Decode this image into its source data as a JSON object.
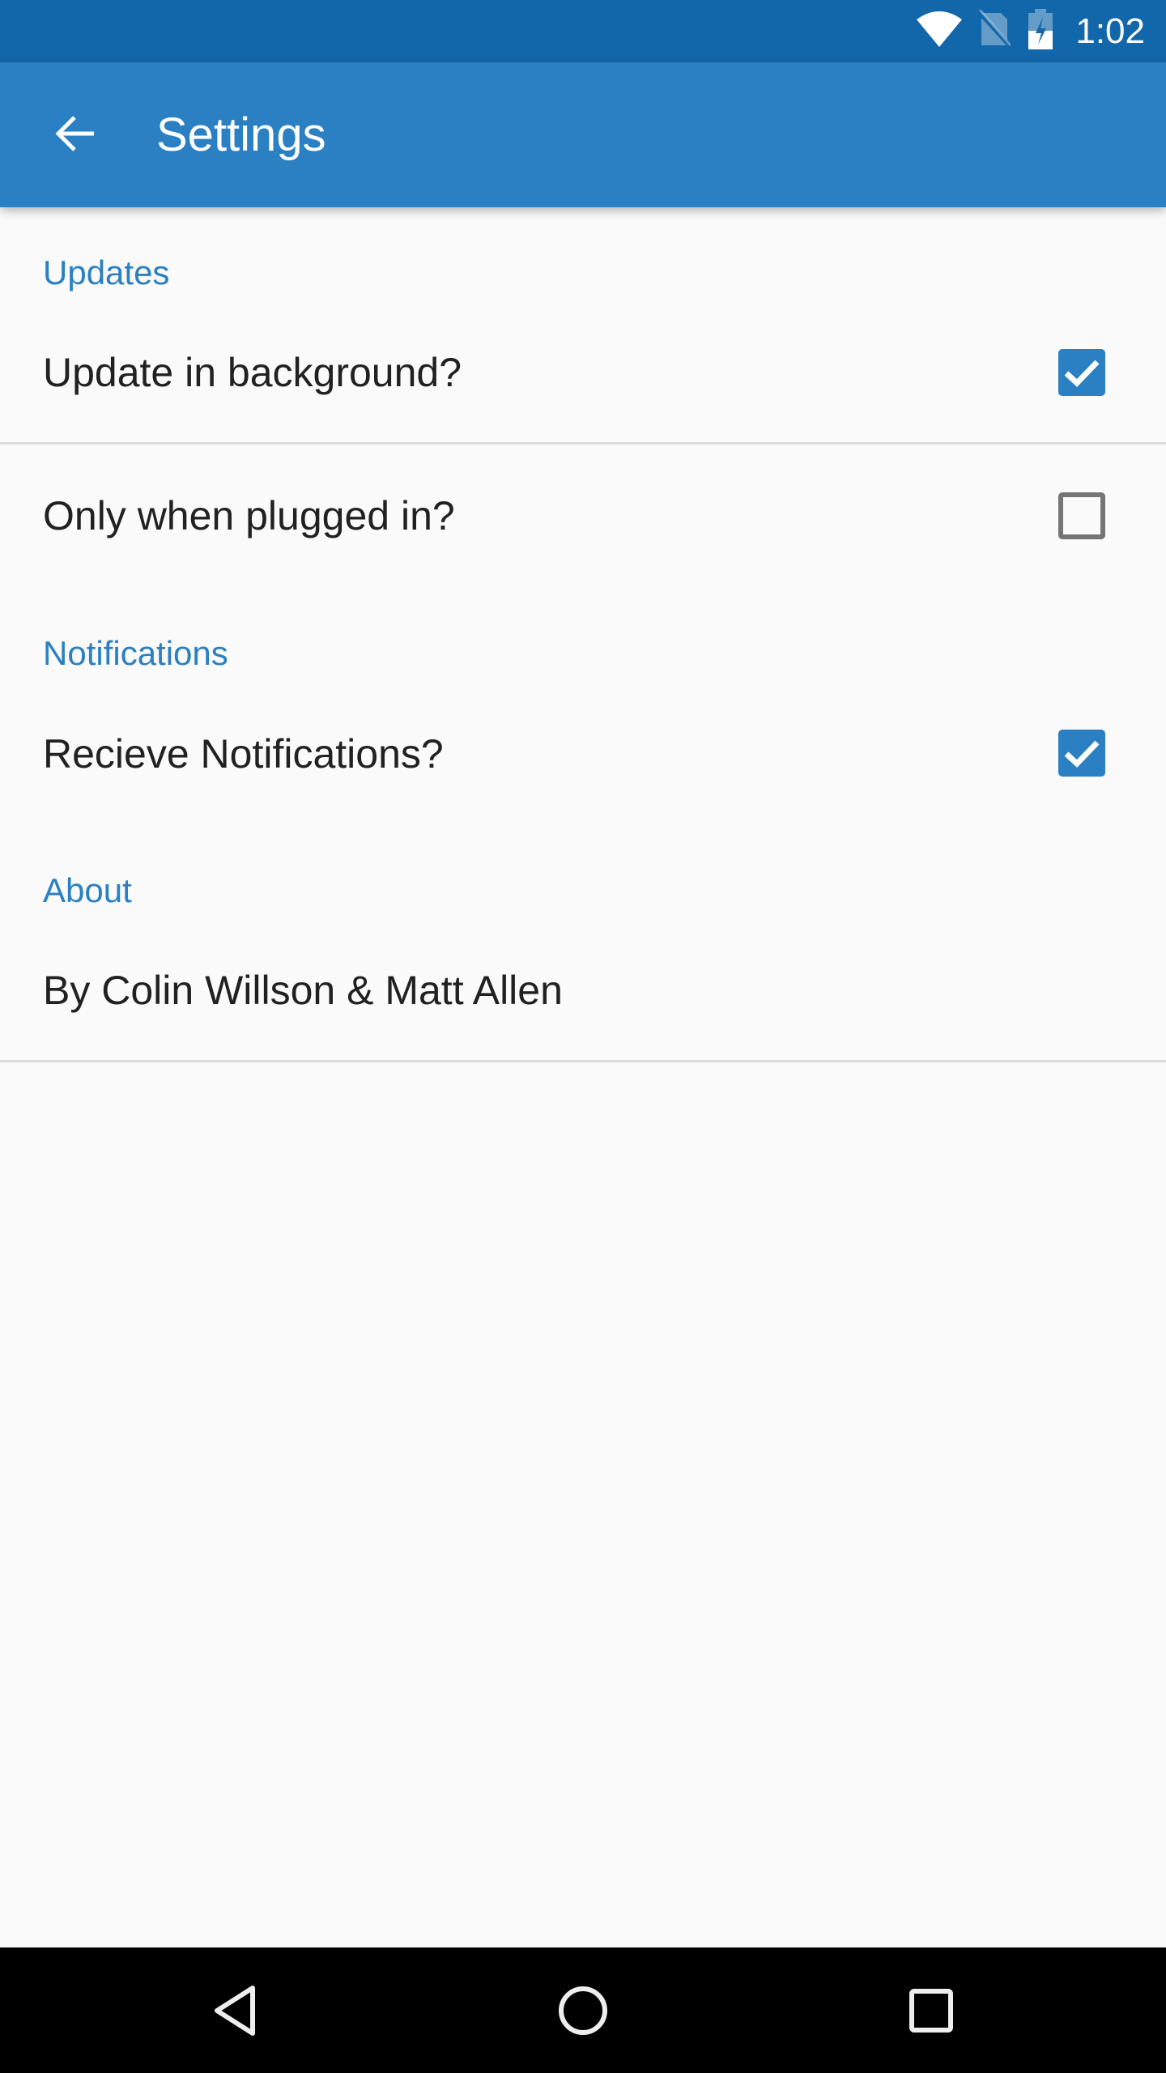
{
  "status_bar": {
    "time": "1:02",
    "icons": [
      "wifi-icon",
      "no-sim-icon",
      "battery-charging-icon"
    ]
  },
  "app_bar": {
    "back_icon": "arrow-back-icon",
    "title": "Settings"
  },
  "colors": {
    "status_bar": "#1167aa",
    "primary": "#2a80c2",
    "text": "#212121",
    "background": "#fafafa",
    "divider": "#dcdcdc"
  },
  "sections": [
    {
      "title": "Updates",
      "items": [
        {
          "label": "Update in background?",
          "checked": true
        },
        {
          "label": "Only when plugged in?",
          "checked": false
        }
      ]
    },
    {
      "title": "Notifications",
      "items": [
        {
          "label": "Recieve Notifications?",
          "checked": true
        }
      ]
    },
    {
      "title": "About",
      "items": [
        {
          "label": "By Colin Willson & Matt Allen"
        }
      ]
    }
  ],
  "nav_bar": {
    "buttons": [
      "back-nav-icon",
      "home-icon",
      "recents-icon"
    ]
  }
}
